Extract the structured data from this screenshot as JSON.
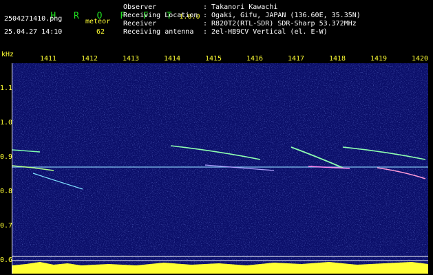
{
  "app": {
    "name": "H R O F F T",
    "version": "1.0.0",
    "mode": "meteor"
  },
  "file": {
    "name": "2504271410.png",
    "datetime": "25.04.27 14:10",
    "count": "62"
  },
  "info": [
    {
      "label": "Observer",
      "value": ": Takanori Kawachi"
    },
    {
      "label": "Receiving Location",
      "value": ": Ogaki, Gifu, JAPAN (136.60E, 35.35N)"
    },
    {
      "label": "Receiver",
      "value": ": R820T2(RTL-SDR) SDR-Sharp 53.372MHz"
    },
    {
      "label": "Receiving antenna",
      "value": ": 2el-HB9CV Vertical (el. E-W)"
    }
  ],
  "axes": {
    "y_unit": "kHz",
    "y_ticks": [
      "1.1",
      "1.0",
      "0.9",
      "0.8",
      "0.7",
      "0.6"
    ],
    "x_ticks": [
      "1411",
      "1412",
      "1413",
      "1414",
      "1415",
      "1416",
      "1417",
      "1418",
      "1419",
      "1420"
    ]
  },
  "colors": {
    "title": "#21e021",
    "label": "#ffff33",
    "noise_bg": "#0b0f6a",
    "trace": "#8effb0"
  }
}
